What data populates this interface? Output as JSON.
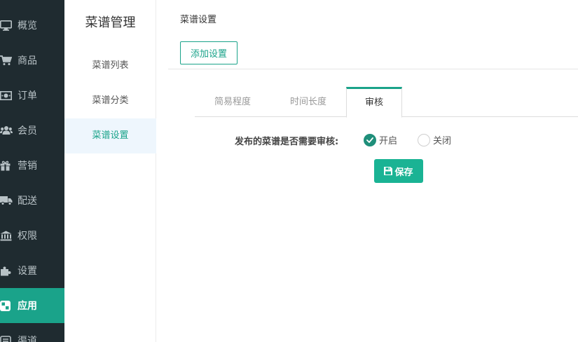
{
  "nav": {
    "items": [
      {
        "label": "概览",
        "icon": "monitor-icon"
      },
      {
        "label": "商品",
        "icon": "cart-icon"
      },
      {
        "label": "订单",
        "icon": "money-icon"
      },
      {
        "label": "会员",
        "icon": "users-icon"
      },
      {
        "label": "营销",
        "icon": "gift-icon"
      },
      {
        "label": "配送",
        "icon": "truck-icon"
      },
      {
        "label": "权限",
        "icon": "bank-icon"
      },
      {
        "label": "设置",
        "icon": "puzzle-icon"
      },
      {
        "label": "应用",
        "icon": "apps-icon"
      },
      {
        "label": "渠道",
        "icon": "channel-icon"
      }
    ],
    "active_index": 8
  },
  "submenu": {
    "title": "菜谱管理",
    "items": [
      "菜谱列表",
      "菜谱分类",
      "菜谱设置"
    ],
    "active_index": 2
  },
  "main": {
    "title": "菜谱设置",
    "add_button": "添加设置",
    "tabs": [
      "简易程度",
      "时间长度",
      "审核"
    ],
    "active_tab": 2,
    "form": {
      "label": "发布的菜谱是否需要审核:",
      "options": [
        "开启",
        "关闭"
      ],
      "selected": "开启"
    },
    "save_button": "保存"
  },
  "colors": {
    "accent": "#1aa38a",
    "nav_bg": "#1f2b30",
    "save_bg": "#1ab394"
  }
}
